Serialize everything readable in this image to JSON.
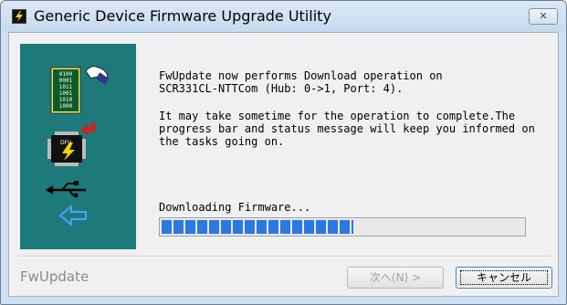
{
  "window": {
    "title": "Generic Device Firmware Upgrade Utility",
    "app_icon": "lightning-icon",
    "close_glyph": "✕"
  },
  "message": {
    "line1": "FwUpdate now performs Download operation on",
    "line2": "SCR331CL-NTTCom (Hub: 0->1, Port: 4).",
    "line3": "It may take sometime for the operation to complete.The",
    "line4": "progress bar and status message will keep you informed on",
    "line5": "the tasks going on."
  },
  "progress": {
    "label": "Downloading Firmware...",
    "fraction": 0.53
  },
  "side_panel": {
    "background": "#1e7a7a",
    "binary_rows": [
      "0100",
      "0001",
      "1011",
      "1001",
      "1010",
      "1000"
    ],
    "chip_label": "DFU",
    "icons": [
      "binary-data-icon",
      "hand-icon",
      "arrow-icon",
      "chip-icon",
      "usb-icon",
      "back-arrow-icon"
    ]
  },
  "footer": {
    "label": "FwUpdate",
    "next_button": "次へ(N) >",
    "cancel_button": "キャンセル"
  },
  "colors": {
    "progress_fill": "#2b78e4",
    "title_bar": "#c6daef"
  }
}
